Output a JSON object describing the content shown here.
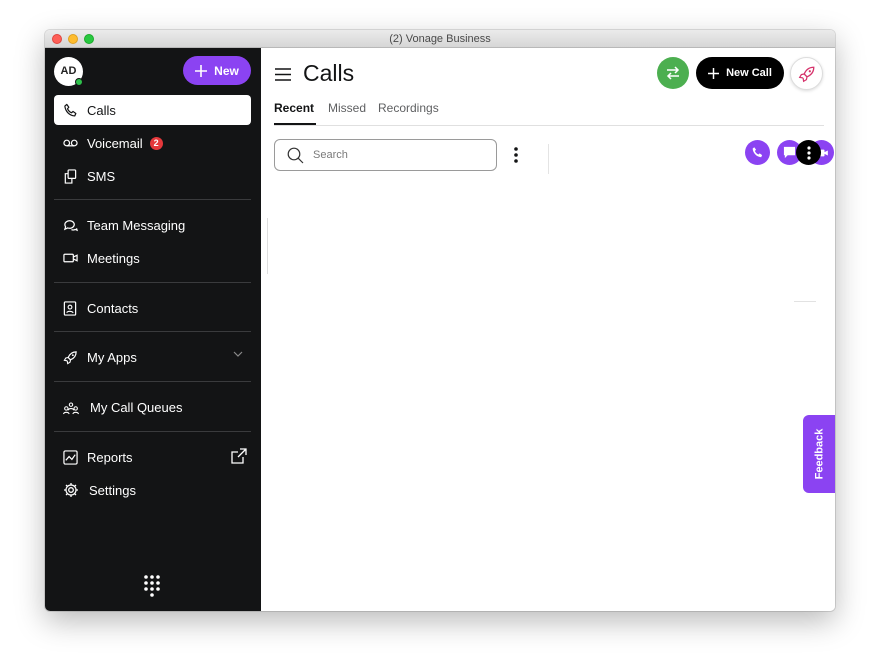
{
  "window": {
    "title": "(2) Vonage Business"
  },
  "sidebar": {
    "avatar_initials": "AD",
    "new_button_label": "New",
    "items": [
      {
        "label": "Calls",
        "icon": "phone-icon",
        "active": true
      },
      {
        "label": "Voicemail",
        "icon": "voicemail-icon",
        "badge": "2"
      },
      {
        "label": "SMS",
        "icon": "sms-icon"
      },
      {
        "label": "Team Messaging",
        "icon": "chat-bubbles-icon"
      },
      {
        "label": "Meetings",
        "icon": "video-icon"
      },
      {
        "label": "Contacts",
        "icon": "contacts-icon"
      },
      {
        "label": "My Apps",
        "icon": "rocket-icon"
      },
      {
        "label": "My Call Queues",
        "icon": "call-queues-icon"
      },
      {
        "label": "Reports",
        "icon": "reports-icon"
      },
      {
        "label": "Settings",
        "icon": "gear-icon"
      }
    ]
  },
  "header": {
    "title": "Calls",
    "new_call_label": "New Call"
  },
  "tabs": [
    {
      "label": "Recent",
      "active": true
    },
    {
      "label": "Missed"
    },
    {
      "label": "Recordings"
    }
  ],
  "search": {
    "placeholder": "Search",
    "value": ""
  },
  "feedback": {
    "label": "Feedback"
  },
  "colors": {
    "accent": "#8b43f2",
    "sidebar_bg": "#131415",
    "swap_green": "#4caf50",
    "badge_red": "#e5383b"
  }
}
